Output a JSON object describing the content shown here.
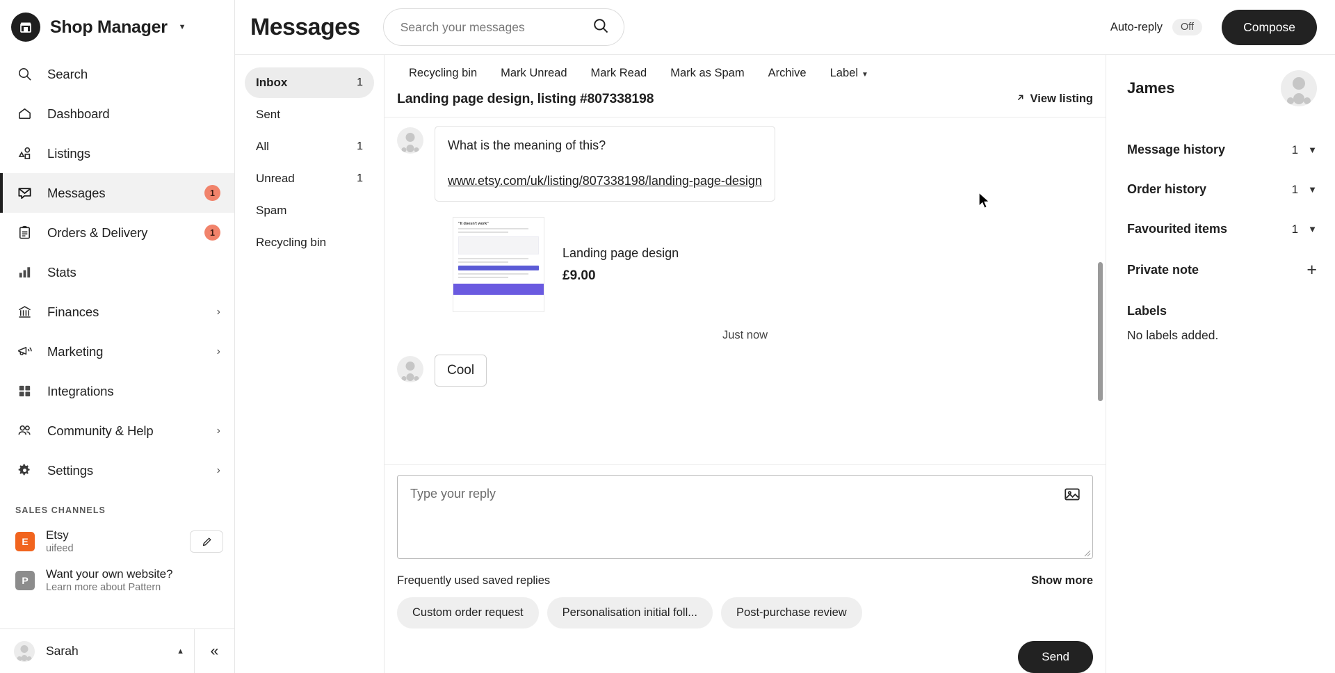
{
  "sidebar": {
    "brand": {
      "title": "Shop Manager",
      "logo_icon": "etsy-shop-icon",
      "caret_icon": "chevron-down-icon"
    },
    "items": [
      {
        "label": "Search",
        "icon": "search-icon",
        "badge": "",
        "chevron": ""
      },
      {
        "label": "Dashboard",
        "icon": "home-icon",
        "badge": "",
        "chevron": ""
      },
      {
        "label": "Listings",
        "icon": "shapes-icon",
        "badge": "",
        "chevron": ""
      },
      {
        "label": "Messages",
        "icon": "envelope-icon",
        "badge": "1",
        "chevron": ""
      },
      {
        "label": "Orders & Delivery",
        "icon": "clipboard-icon",
        "badge": "1",
        "chevron": ""
      },
      {
        "label": "Stats",
        "icon": "bar-chart-icon",
        "badge": "",
        "chevron": ""
      },
      {
        "label": "Finances",
        "icon": "bank-icon",
        "badge": "",
        "chevron": "›"
      },
      {
        "label": "Marketing",
        "icon": "megaphone-icon",
        "badge": "",
        "chevron": "›"
      },
      {
        "label": "Integrations",
        "icon": "grid-icon",
        "badge": "",
        "chevron": ""
      },
      {
        "label": "Community & Help",
        "icon": "people-icon",
        "badge": "",
        "chevron": "›"
      },
      {
        "label": "Settings",
        "icon": "gear-icon",
        "badge": "",
        "chevron": "›"
      }
    ],
    "sales_channels_title": "SALES CHANNELS",
    "channels": [
      {
        "badge": "E",
        "name": "Etsy",
        "sub": "uifeed",
        "has_edit": true
      },
      {
        "badge": "P",
        "name": "Want your own website?",
        "sub": "Learn more about Pattern",
        "has_edit": false
      }
    ],
    "user": {
      "name": "Sarah",
      "caret_icon": "chevron-up-icon"
    },
    "collapse_icon": "chevron-double-left-icon"
  },
  "header": {
    "title": "Messages",
    "search_placeholder": "Search your messages",
    "search_value": "",
    "search_icon": "search-icon",
    "auto_reply_label": "Auto-reply",
    "auto_reply_state": "Off",
    "compose_label": "Compose"
  },
  "folders": [
    {
      "label": "Inbox",
      "count": "1",
      "active": true
    },
    {
      "label": "Sent",
      "count": "",
      "active": false
    },
    {
      "label": "All",
      "count": "1",
      "active": false
    },
    {
      "label": "Unread",
      "count": "1",
      "active": false
    },
    {
      "label": "Spam",
      "count": "",
      "active": false
    },
    {
      "label": "Recycling bin",
      "count": "",
      "active": false
    }
  ],
  "thread": {
    "toolbar": [
      {
        "label": "Recycling bin",
        "caret": false
      },
      {
        "label": "Mark Unread",
        "caret": false
      },
      {
        "label": "Mark Read",
        "caret": false
      },
      {
        "label": "Mark as Spam",
        "caret": false
      },
      {
        "label": "Archive",
        "caret": false
      },
      {
        "label": "Label",
        "caret": true
      }
    ],
    "subject": "Landing page design, listing #807338198",
    "view_listing_label": "View listing",
    "view_listing_icon": "arrow-up-right-icon",
    "messages": [
      {
        "text": "What is the meaning of this?",
        "link": "www.etsy.com/uk/listing/807338198/landing-page-design"
      }
    ],
    "listing_card": {
      "thumb_caption": "\"It doesn't work\"",
      "name": "Landing page design",
      "price": "£9.00"
    },
    "timestamp": "Just now",
    "reply_message": "Cool"
  },
  "composer": {
    "placeholder": "Type your reply",
    "value": "",
    "image_icon": "image-icon",
    "saved_replies_title": "Frequently used saved replies",
    "show_more_label": "Show more",
    "chips": [
      "Custom order request",
      "Personalisation initial foll...",
      "Post-purchase review"
    ],
    "send_label": "Send"
  },
  "details": {
    "name": "James",
    "rows": [
      {
        "label": "Message history",
        "count": "1",
        "control": "chevron-down-icon"
      },
      {
        "label": "Order history",
        "count": "1",
        "control": "chevron-down-icon"
      },
      {
        "label": "Favourited items",
        "count": "1",
        "control": "chevron-down-icon"
      },
      {
        "label": "Private note",
        "count": "",
        "control": "plus-icon"
      }
    ],
    "labels_title": "Labels",
    "labels_empty": "No labels added."
  },
  "colors": {
    "accent_dark": "#222222",
    "badge_orange": "#f1836b",
    "etsy_orange": "#f1641e"
  }
}
